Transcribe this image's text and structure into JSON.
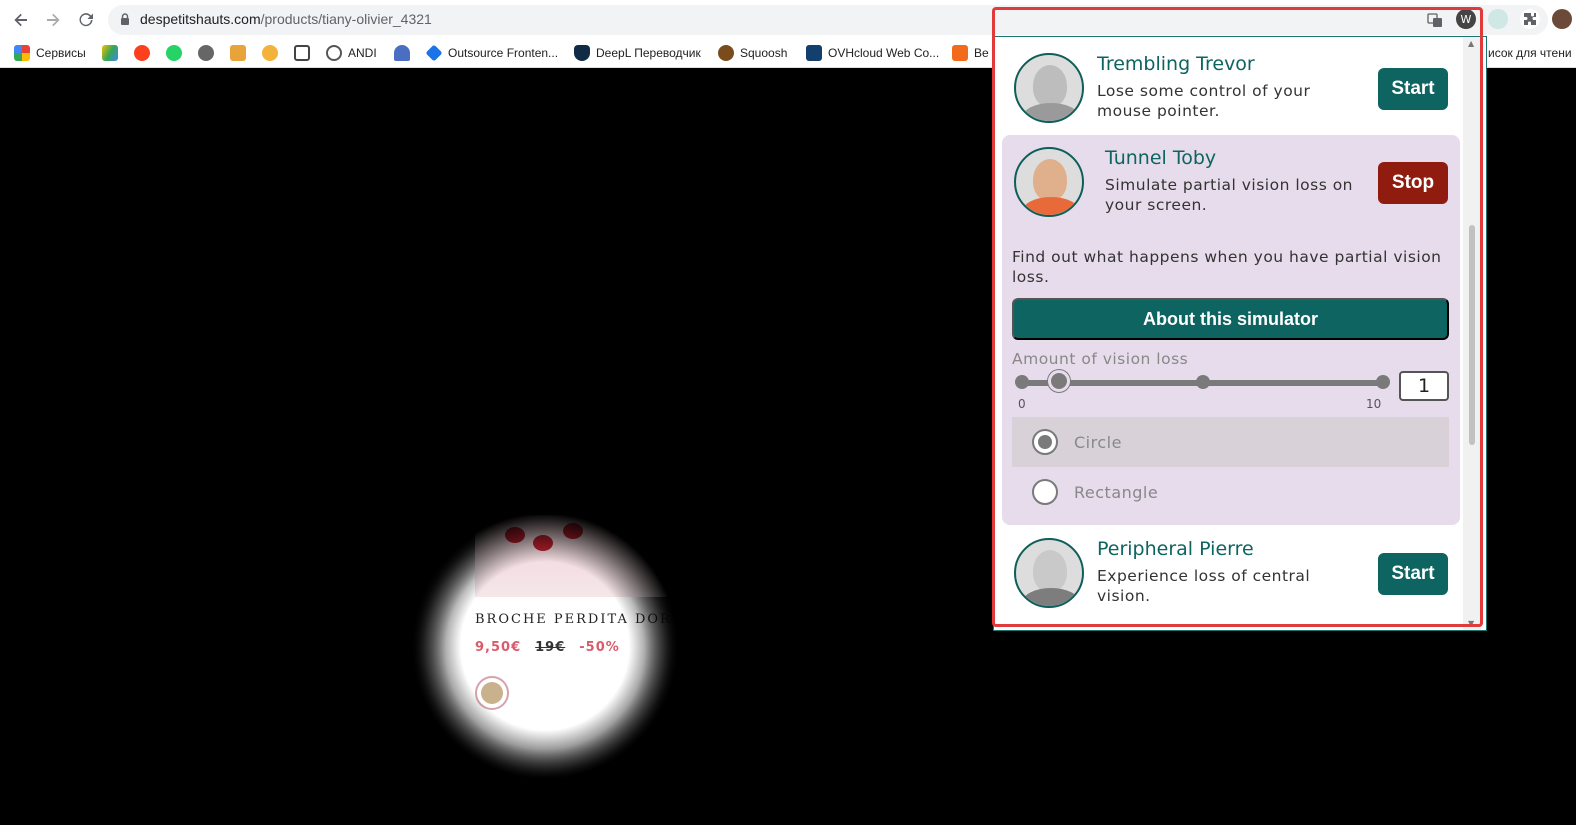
{
  "browser": {
    "url_domain": "despetitshauts.com",
    "url_path": "/products/tiany-olivier_4321"
  },
  "bookmarks": [
    {
      "label": "Сервисы",
      "icon": "apps-grid-icon",
      "color": "#e94235"
    },
    {
      "label": "",
      "icon": "google-drive-icon",
      "color": "#1fa463"
    },
    {
      "label": "",
      "icon": "yandex-icon",
      "color": "#fc3f1d"
    },
    {
      "label": "",
      "icon": "whatsapp-icon",
      "color": "#25d366"
    },
    {
      "label": "",
      "icon": "power-icon",
      "color": "#666666"
    },
    {
      "label": "",
      "icon": "trello-icon",
      "color": "#e8a33b"
    },
    {
      "label": "",
      "icon": "chromatic-icon",
      "color": "#f3b23a"
    },
    {
      "label": "",
      "icon": "code-icon",
      "color": "#444444"
    },
    {
      "label": "ANDI",
      "icon": "globe-icon",
      "color": "#555555"
    },
    {
      "label": "",
      "icon": "wifi-icon",
      "color": "#4a6fc2"
    },
    {
      "label": "Outsource Fronten...",
      "icon": "diamond-icon",
      "color": "#1a73e8"
    },
    {
      "label": "DeepL Переводчик",
      "icon": "deepl-icon",
      "color": "#0f2b46"
    },
    {
      "label": "Squoosh",
      "icon": "squoosh-icon",
      "color": "#7a4b1c"
    },
    {
      "label": "OVHcloud Web Co...",
      "icon": "ovh-icon",
      "color": "#123f6d"
    },
    {
      "label": "Be",
      "icon": "behance-icon",
      "color": "#f26b1d"
    },
    {
      "label": "исок для чтени",
      "icon": "reading-list-icon",
      "color": "#555555"
    }
  ],
  "product": {
    "name": "BROCHE PERDITA DOR",
    "price": "9,50€",
    "old_price": "19€",
    "discount": "-50%"
  },
  "popup": {
    "simulators": [
      {
        "name": "Trembling Trevor",
        "description": "Lose some control of your mouse pointer.",
        "action": "Start",
        "active": false
      },
      {
        "name": "Tunnel Toby",
        "description": "Simulate partial vision loss on your screen.",
        "action": "Stop",
        "active": true
      },
      {
        "name": "Peripheral Pierre",
        "description": "Experience loss of central vision.",
        "action": "Start",
        "active": false
      }
    ],
    "find_out": "Find out what happens when you have partial vision loss.",
    "about_button": "About this simulator",
    "amount_label": "Amount of vision loss",
    "slider_min": "0",
    "slider_max": "10",
    "amount_value": "1",
    "shapes": [
      {
        "label": "Circle",
        "selected": true
      },
      {
        "label": "Rectangle",
        "selected": false
      }
    ]
  },
  "colors": {
    "brand_teal": "#0e6460",
    "stop_red": "#8f1c0e",
    "panel_bg": "#e7dcec",
    "highlight": "#e03a3a"
  }
}
